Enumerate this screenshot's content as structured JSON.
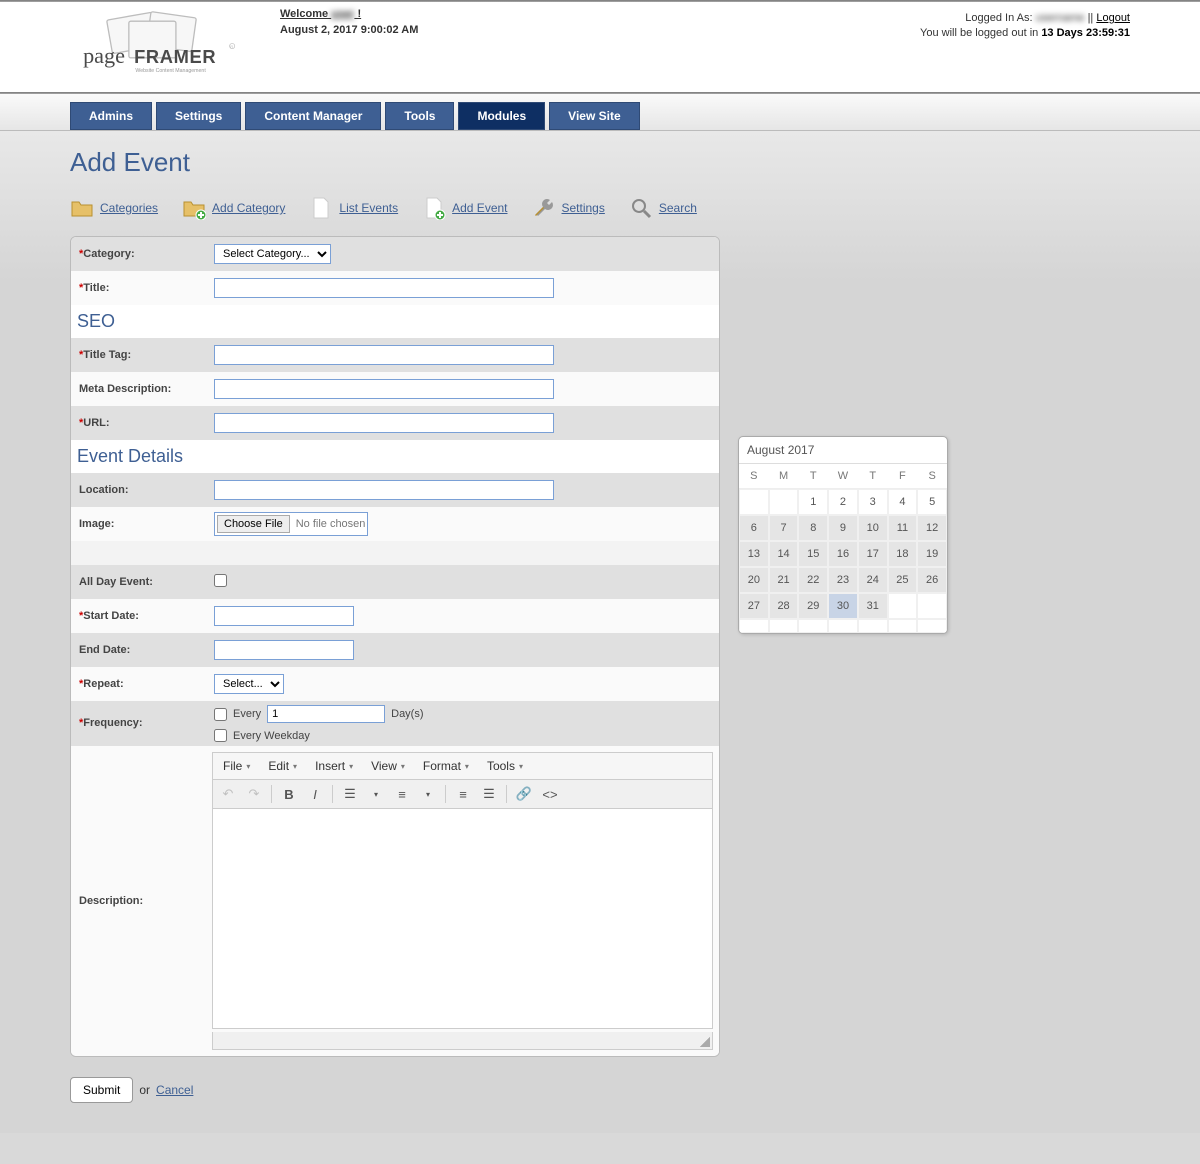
{
  "header": {
    "welcome_prefix": "Welcome ",
    "welcome_name": "user",
    "welcome_suffix": " !",
    "date_line": "August 2, 2017 9:00:02 AM",
    "logged_in_prefix": "Logged In As: ",
    "logged_in_name": "username",
    "sep": " || ",
    "logout": "Logout",
    "countdown_prefix": "You will be logged out in ",
    "countdown_value": "13 Days 23:59:31",
    "logo_main": "page",
    "logo_sub": "FRAMER",
    "logo_tagline": "Website Content Management"
  },
  "nav": {
    "items": [
      "Admins",
      "Settings",
      "Content Manager",
      "Tools",
      "Modules",
      "View Site"
    ],
    "active_index": 4
  },
  "page_title": "Add Event",
  "toolbar": {
    "items": [
      {
        "label": "Categories",
        "icon": "folder"
      },
      {
        "label": "Add Category",
        "icon": "folder-plus"
      },
      {
        "label": "List Events",
        "icon": "page"
      },
      {
        "label": "Add Event",
        "icon": "page-plus"
      },
      {
        "label": "Settings",
        "icon": "wrench"
      },
      {
        "label": "Search",
        "icon": "magnifier"
      }
    ]
  },
  "form": {
    "category_label": "Category:",
    "category_select": "Select Category...",
    "title_label": "Title:",
    "seo_heading": "SEO",
    "title_tag_label": "Title Tag:",
    "meta_desc_label": "Meta Description:",
    "url_label": "URL:",
    "details_heading": "Event Details",
    "location_label": "Location:",
    "image_label": "Image:",
    "choose_file": "Choose File",
    "no_file": "No file chosen",
    "all_day_label": "All Day Event:",
    "start_date_label": "Start Date:",
    "end_date_label": "End Date:",
    "repeat_label": "Repeat:",
    "repeat_select": "Select...",
    "frequency_label": "Frequency:",
    "freq_every": "Every",
    "freq_value": "1",
    "freq_days": "Day(s)",
    "freq_weekday": "Every Weekday",
    "description_label": "Description:"
  },
  "editor": {
    "menu": [
      "File",
      "Edit",
      "Insert",
      "View",
      "Format",
      "Tools"
    ]
  },
  "calendar": {
    "title": "August 2017",
    "day_headers": [
      "S",
      "M",
      "T",
      "W",
      "T",
      "F",
      "S"
    ],
    "leading_blanks": 2,
    "days": 31,
    "today": 30,
    "shaded_rows_start": 6
  },
  "submit": {
    "button": "Submit",
    "or": " or ",
    "cancel": "Cancel"
  }
}
